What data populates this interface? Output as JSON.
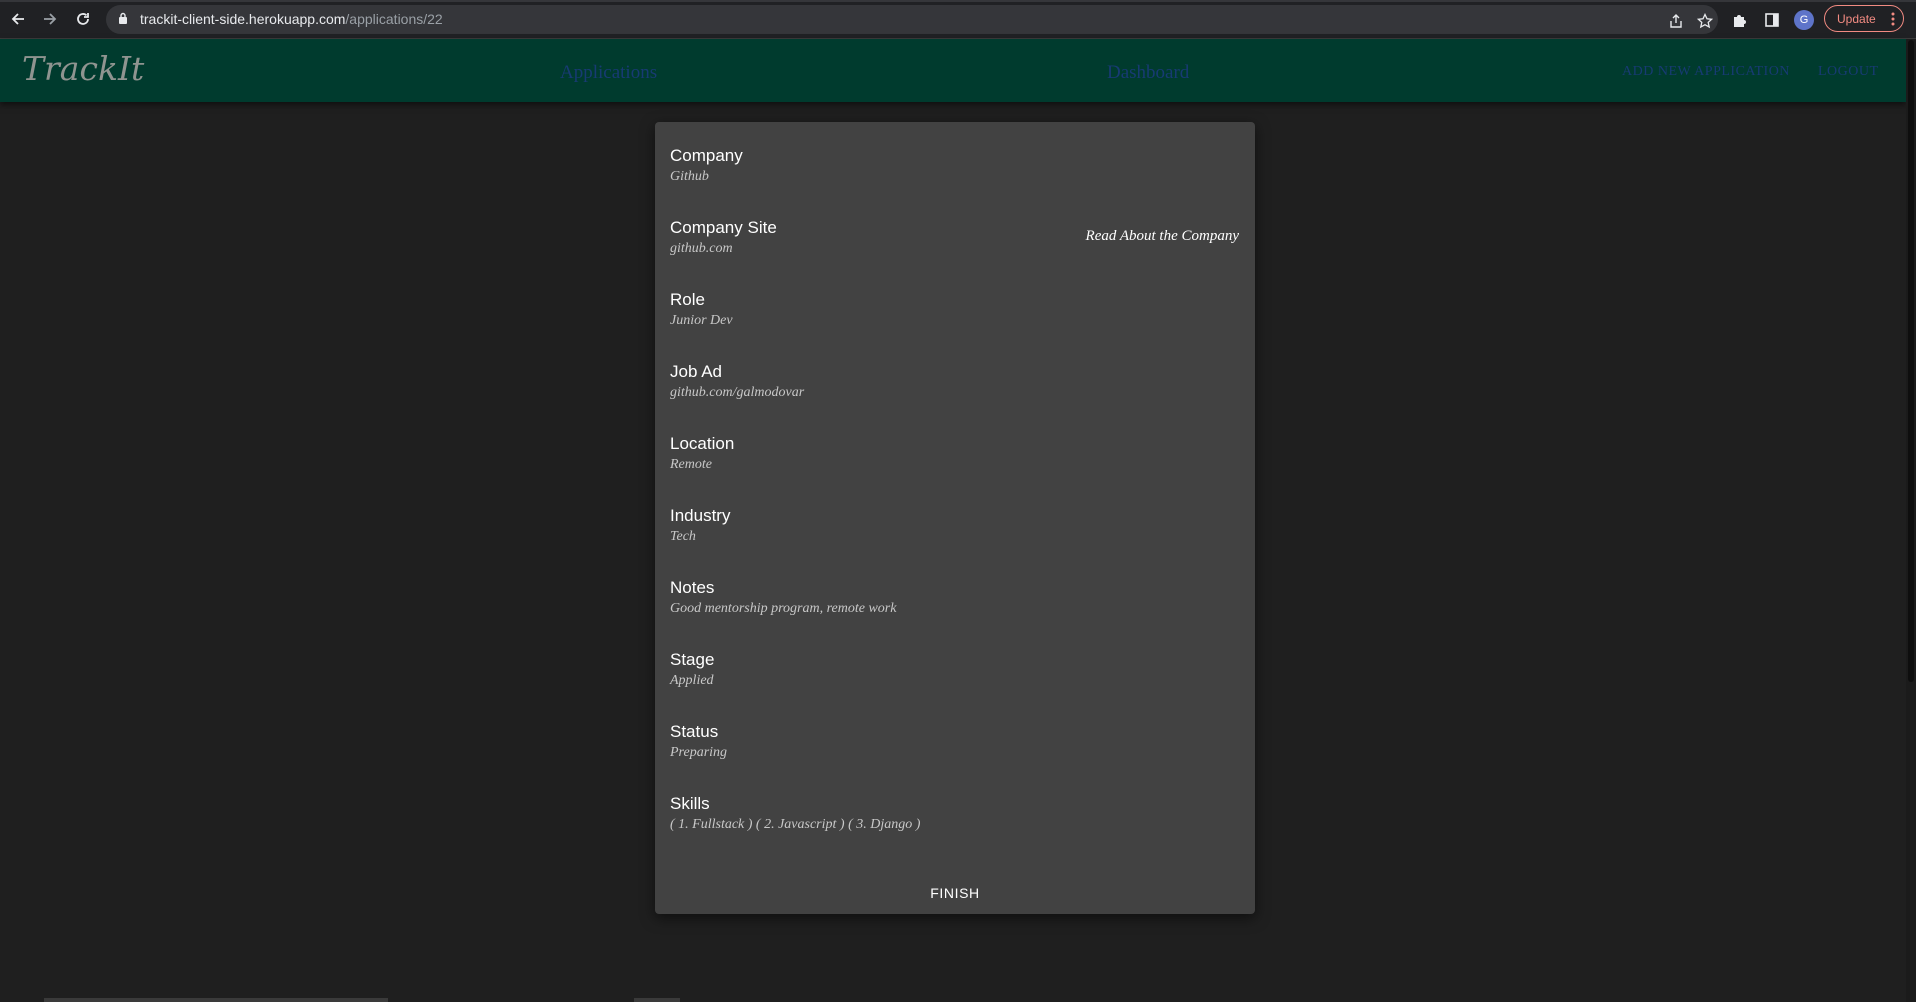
{
  "browser": {
    "url_host": "trackit-client-side.herokuapp.com",
    "url_path": "/applications/22",
    "profile_initial": "G",
    "update_label": "Update"
  },
  "header": {
    "brand": "TrackIt",
    "nav": {
      "applications": "Applications",
      "dashboard": "Dashboard",
      "add_new": "ADD NEW APPLICATION",
      "logout": "LOGOUT"
    }
  },
  "card": {
    "fields": [
      {
        "label": "Company",
        "value": "Github"
      },
      {
        "label": "Company Site",
        "value": "github.com"
      },
      {
        "label": "Role",
        "value": "Junior Dev"
      },
      {
        "label": "Job Ad",
        "value": "github.com/galmodovar"
      },
      {
        "label": "Location",
        "value": "Remote"
      },
      {
        "label": "Industry",
        "value": "Tech"
      },
      {
        "label": "Notes",
        "value": "Good mentorship program, remote work"
      },
      {
        "label": "Stage",
        "value": "Applied"
      },
      {
        "label": "Status",
        "value": "Preparing"
      },
      {
        "label": "Skills",
        "value": "( 1. Fullstack ) ( 2. Javascript ) ( 3. Django )"
      }
    ],
    "read_about_link": "Read About the Company",
    "finish_label": "FINISH"
  }
}
